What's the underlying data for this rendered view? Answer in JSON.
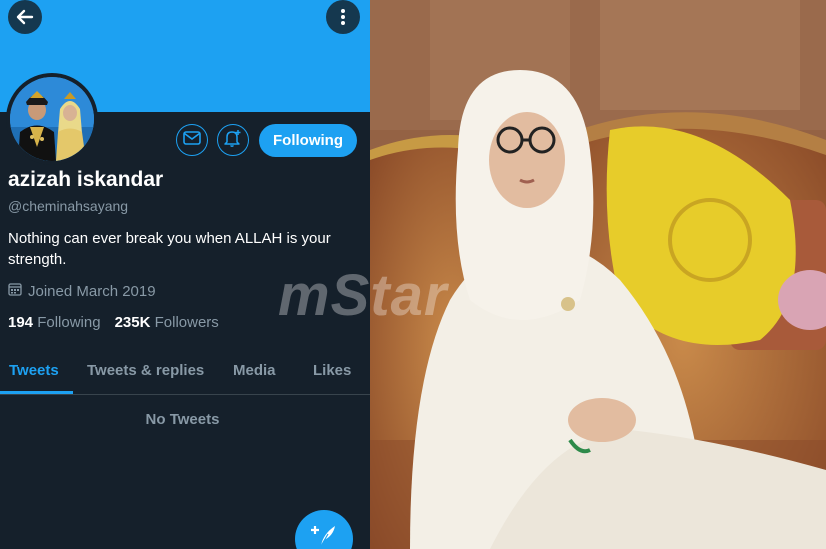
{
  "profile": {
    "display_name": "azizah iskandar",
    "handle": "@cheminahsayang",
    "bio": "Nothing can ever break you when ALLAH is your strength.",
    "joined": "Joined March 2019",
    "following_count": "194",
    "following_label": "Following",
    "followers_count": "235K",
    "followers_label": "Followers",
    "follow_button_label": "Following"
  },
  "tabs": [
    {
      "label": "Tweets",
      "active": true
    },
    {
      "label": "Tweets & replies",
      "active": false
    },
    {
      "label": "Media",
      "active": false
    },
    {
      "label": "Likes",
      "active": false
    }
  ],
  "empty_state": "No Tweets",
  "watermark": "mStar",
  "icons": {
    "back": "back-arrow-icon",
    "more": "more-vertical-icon",
    "message": "envelope-icon",
    "notify": "bell-plus-icon",
    "calendar": "calendar-icon",
    "compose": "feather-plus-icon"
  },
  "colors": {
    "accent": "#1da1f2",
    "background": "#15202b",
    "secondary_text": "#8899a6"
  }
}
